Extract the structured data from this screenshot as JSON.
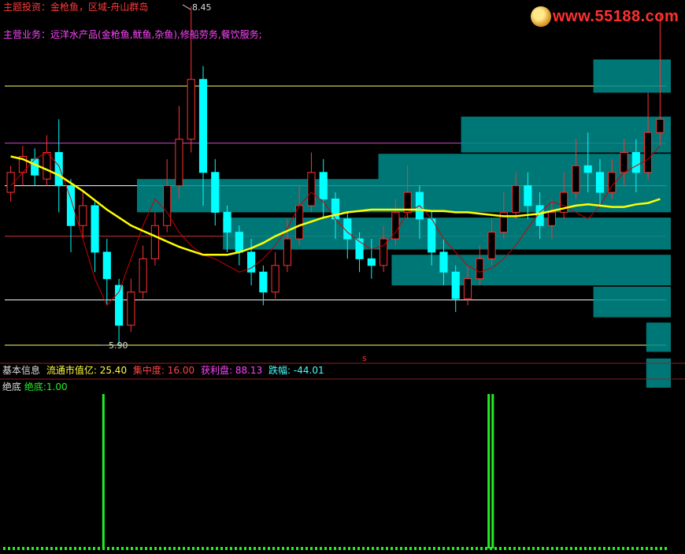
{
  "header": {
    "theme_label": "主题投资：",
    "theme_value": "金枪鱼，区域-舟山群岛",
    "business_label": "主营业务：",
    "business_value": "远洋水产品(金枪鱼,鱿鱼,杂鱼),修船劳务,餐饮服务;",
    "logo_text": "www.55188.com"
  },
  "info_bar": {
    "title": "基本信息",
    "float_cap_label": "流通市值亿:",
    "float_cap_value": "25.40",
    "concentration_label": "集中度:",
    "concentration_value": "16.00",
    "profit_label": "获利盘:",
    "profit_value": "88.13",
    "change_label": "跌幅:",
    "change_value": "-44.01"
  },
  "sub_panel": {
    "title": "绝底",
    "indicator_label": "绝底:",
    "indicator_value": "1.00"
  },
  "marker_s": "s",
  "colors": {
    "up": "#ff3232",
    "down": "#00ffff",
    "ma_yellow": "#ffff00",
    "ma_red": "#cc0000",
    "chip_box": "#008c8c",
    "signal": "#22ee22"
  },
  "chart_data": {
    "type": "candlestick",
    "high_label": "8.45",
    "low_label": "5.90",
    "ylim": [
      5.9,
      8.45
    ],
    "reference_lines": [
      {
        "color": "#ffff66",
        "price": 7.85
      },
      {
        "color": "#cc44cc",
        "price": 7.42
      },
      {
        "color": "#ffffff",
        "price": 7.1
      },
      {
        "color": "#cc3333",
        "price": 6.72
      },
      {
        "color": "#ffffff",
        "price": 6.24
      },
      {
        "color": "#ffff66",
        "price": 5.9
      }
    ],
    "chip_boxes": [
      {
        "price_top": 8.05,
        "price_bottom": 7.8,
        "start": 0.89
      },
      {
        "price_top": 7.62,
        "price_bottom": 7.35,
        "start": 0.69
      },
      {
        "price_top": 7.34,
        "price_bottom": 7.06,
        "start": 0.565
      },
      {
        "price_top": 7.15,
        "price_bottom": 6.9,
        "start": 0.2
      },
      {
        "price_top": 6.86,
        "price_bottom": 6.62,
        "start": 0.33
      },
      {
        "price_top": 6.58,
        "price_bottom": 6.35,
        "start": 0.585
      },
      {
        "price_top": 6.34,
        "price_bottom": 6.11,
        "start": 0.89
      },
      {
        "price_top": 6.07,
        "price_bottom": 5.85,
        "start": 0.97
      },
      {
        "price_top": 5.8,
        "price_bottom": 5.58,
        "start": 0.97
      }
    ],
    "signal_bars": [
      0.145,
      0.718,
      0.724
    ],
    "ma_yellow": [
      7.32,
      7.3,
      7.26,
      7.22,
      7.18,
      7.12,
      7.06,
      6.99,
      6.92,
      6.86,
      6.8,
      6.76,
      6.72,
      6.68,
      6.64,
      6.61,
      6.58,
      6.58,
      6.58,
      6.6,
      6.63,
      6.67,
      6.72,
      6.76,
      6.8,
      6.83,
      6.86,
      6.88,
      6.9,
      6.91,
      6.92,
      6.92,
      6.92,
      6.92,
      6.92,
      6.91,
      6.91,
      6.9,
      6.9,
      6.89,
      6.88,
      6.87,
      6.87,
      6.88,
      6.89,
      6.91,
      6.93,
      6.95,
      6.96,
      6.95,
      6.94,
      6.94,
      6.96,
      6.97,
      7.0
    ],
    "ma_red": [
      7.1,
      7.2,
      7.3,
      7.35,
      7.25,
      7.0,
      6.7,
      6.4,
      6.2,
      6.3,
      6.55,
      6.8,
      7.0,
      6.9,
      6.75,
      6.65,
      6.58,
      6.55,
      6.5,
      6.45,
      6.48,
      6.55,
      6.65,
      6.78,
      6.95,
      7.05,
      6.98,
      6.85,
      6.75,
      6.68,
      6.62,
      6.65,
      6.75,
      6.9,
      6.95,
      6.85,
      6.7,
      6.6,
      6.5,
      6.45,
      6.48,
      6.55,
      6.65,
      6.78,
      6.9,
      6.98,
      6.95,
      6.9,
      6.85,
      6.95,
      7.1,
      7.2,
      7.25,
      7.3,
      7.4
    ],
    "candles": [
      [
        7.05,
        7.2,
        7.25,
        6.98
      ],
      [
        7.2,
        7.32,
        7.4,
        7.1
      ],
      [
        7.3,
        7.18,
        7.38,
        7.1
      ],
      [
        7.15,
        7.35,
        7.48,
        7.1
      ],
      [
        7.35,
        7.1,
        7.6,
        6.9
      ],
      [
        7.1,
        6.8,
        7.15,
        6.6
      ],
      [
        6.8,
        6.95,
        7.05,
        6.7
      ],
      [
        6.95,
        6.6,
        7.0,
        6.45
      ],
      [
        6.6,
        6.4,
        6.7,
        6.2
      ],
      [
        6.35,
        6.05,
        6.4,
        5.9
      ],
      [
        6.05,
        6.3,
        6.4,
        6.0
      ],
      [
        6.3,
        6.55,
        6.65,
        6.25
      ],
      [
        6.55,
        6.8,
        6.9,
        6.5
      ],
      [
        6.8,
        7.1,
        7.3,
        6.75
      ],
      [
        7.1,
        7.45,
        7.7,
        7.0
      ],
      [
        7.45,
        7.9,
        8.45,
        7.35
      ],
      [
        7.9,
        7.2,
        8.0,
        6.95
      ],
      [
        7.2,
        6.9,
        7.3,
        6.8
      ],
      [
        6.9,
        6.75,
        6.95,
        6.6
      ],
      [
        6.75,
        6.6,
        6.8,
        6.5
      ],
      [
        6.6,
        6.45,
        6.7,
        6.35
      ],
      [
        6.45,
        6.3,
        6.5,
        6.2
      ],
      [
        6.3,
        6.5,
        6.6,
        6.25
      ],
      [
        6.5,
        6.7,
        6.85,
        6.45
      ],
      [
        6.7,
        6.95,
        7.1,
        6.65
      ],
      [
        6.95,
        7.2,
        7.35,
        6.9
      ],
      [
        7.2,
        7.0,
        7.3,
        6.85
      ],
      [
        7.0,
        6.85,
        7.05,
        6.7
      ],
      [
        6.85,
        6.7,
        6.9,
        6.55
      ],
      [
        6.7,
        6.55,
        6.75,
        6.45
      ],
      [
        6.55,
        6.5,
        6.7,
        6.4
      ],
      [
        6.5,
        6.7,
        6.8,
        6.45
      ],
      [
        6.7,
        6.9,
        7.0,
        6.65
      ],
      [
        6.9,
        7.05,
        7.25,
        6.85
      ],
      [
        7.05,
        6.85,
        7.1,
        6.7
      ],
      [
        6.85,
        6.6,
        6.9,
        6.5
      ],
      [
        6.6,
        6.45,
        6.7,
        6.35
      ],
      [
        6.45,
        6.25,
        6.5,
        6.15
      ],
      [
        6.25,
        6.4,
        6.5,
        6.2
      ],
      [
        6.4,
        6.55,
        6.65,
        6.35
      ],
      [
        6.55,
        6.75,
        6.85,
        6.5
      ],
      [
        6.75,
        6.9,
        7.05,
        6.7
      ],
      [
        6.9,
        7.1,
        7.2,
        6.85
      ],
      [
        7.1,
        6.95,
        7.2,
        6.85
      ],
      [
        6.95,
        6.8,
        7.05,
        6.7
      ],
      [
        6.8,
        6.9,
        7.0,
        6.7
      ],
      [
        6.9,
        7.05,
        7.2,
        6.85
      ],
      [
        7.05,
        7.25,
        7.45,
        7.0
      ],
      [
        7.25,
        7.2,
        7.5,
        7.05
      ],
      [
        7.2,
        7.05,
        7.3,
        6.95
      ],
      [
        7.05,
        7.2,
        7.3,
        7.0
      ],
      [
        7.2,
        7.35,
        7.45,
        7.1
      ],
      [
        7.35,
        7.2,
        7.45,
        7.05
      ],
      [
        7.2,
        7.5,
        7.8,
        7.15
      ],
      [
        7.5,
        7.6,
        8.4,
        7.4
      ]
    ]
  }
}
